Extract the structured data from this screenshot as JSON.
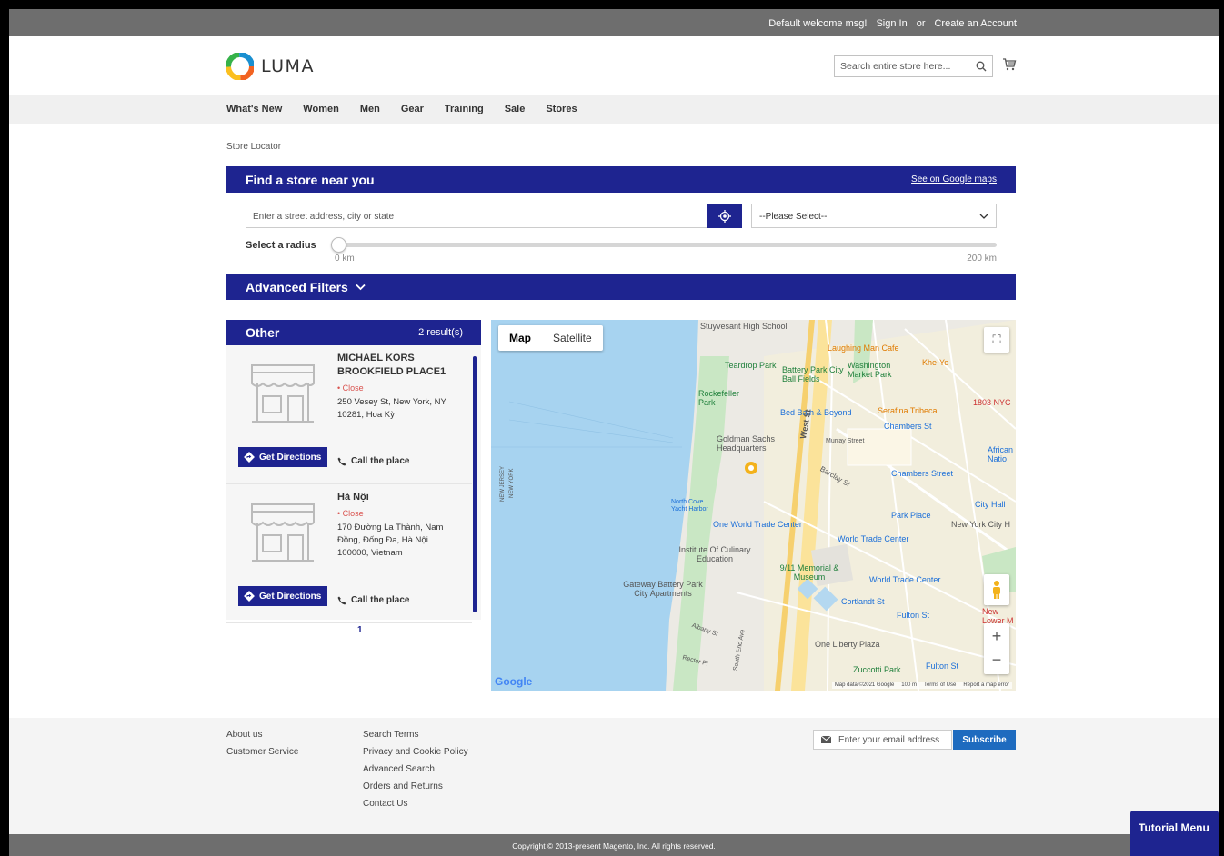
{
  "topbar": {
    "welcome": "Default welcome msg!",
    "sign_in": "Sign In",
    "or": "or",
    "create_account": "Create an Account"
  },
  "header": {
    "logo_text": "LUMA",
    "search_placeholder": "Search entire store here...",
    "icons": [
      "search-icon",
      "cart-icon"
    ]
  },
  "nav": {
    "items": [
      "What's New",
      "Women",
      "Men",
      "Gear",
      "Training",
      "Sale",
      "Stores"
    ]
  },
  "breadcrumb": "Store Locator",
  "finder": {
    "title": "Find a store near you",
    "google_link": "See on Google maps",
    "address_placeholder": "Enter a street address, city or state",
    "select_value": "--Please Select--",
    "radius_label": "Select a radius",
    "radius_min": "0 km",
    "radius_max": "200 km",
    "radius_value_fraction": 0,
    "advanced_filters": "Advanced Filters"
  },
  "results": {
    "group": "Other",
    "count": "2 result(s)",
    "stores": [
      {
        "name": "MICHAEL KORS BROOKFIELD PLACE1",
        "status": "Close",
        "address": "250 Vesey St, New York, NY 10281, Hoa Kỳ",
        "directions": "Get Directions",
        "call": "Call the place"
      },
      {
        "name": "Hà Nội",
        "status": "Close",
        "address": "170 Đường La Thành, Nam Đồng, Đống Đa, Hà Nội 100000, Vietnam",
        "directions": "Get Directions",
        "call": "Call the place"
      }
    ],
    "page": "1"
  },
  "map": {
    "tab_map": "Map",
    "tab_satellite": "Satellite",
    "labels": {
      "stuyvesant": "Stuyvesant High School",
      "laughing_man": "Laughing Man Cafe",
      "khe_yo": "Khe-Yo",
      "teardrop": "Teardrop Park",
      "battery_park_city": "Battery Park City Ball Fields",
      "washington_market": "Washington Market Park",
      "rockefeller": "Rockefeller Park",
      "bed_bath": "Bed Bath & Beyond",
      "serafina": "Serafina Tribeca",
      "nyc1803": "1803 NYC",
      "chambers_st": "Chambers St",
      "goldman": "Goldman Sachs Headquarters",
      "murray": "Murray Street",
      "african": "African Natio",
      "chambers_street": "Chambers Street",
      "west_st": "West St",
      "barclay": "Barclay St",
      "new_jersey": "NEW JERSEY",
      "new_york": "NEW YORK",
      "north_cove": "North Cove Yacht Harbor",
      "one_wtc": "One World Trade Center",
      "park_place": "Park Place",
      "city_hall": "City Hall",
      "ny_city_h": "New York City H",
      "wtc_station": "World Trade Center",
      "institute": "Institute Of Culinary Education",
      "memorial": "9/11 Memorial & Museum",
      "wtc_path": "World Trade Center",
      "gateway": "Gateway Battery Park City Apartments",
      "cortlandt": "Cortlandt St",
      "fulton_st": "Fulton St",
      "new_lower": "New Lower M",
      "one_liberty": "One Liberty Plaza",
      "zuccotti": "Zuccotti Park",
      "fulton_st2": "Fulton St",
      "albany": "Albany St",
      "rector": "Rector Pl",
      "south_end": "South End Ave"
    },
    "footer_data": "Map data ©2021 Google",
    "footer_scale": "100 m",
    "footer_terms": "Terms of Use",
    "footer_report": "Report a map error",
    "google": "Google"
  },
  "footer": {
    "col1": [
      "About us",
      "Customer Service"
    ],
    "col2": [
      "Search Terms",
      "Privacy and Cookie Policy",
      "Advanced Search",
      "Orders and Returns",
      "Contact Us"
    ],
    "newsletter_placeholder": "Enter your email address",
    "subscribe": "Subscribe",
    "copyright": "Copyright © 2013-present Magento, Inc. All rights reserved."
  },
  "tutorial_menu": "Tutorial Menu",
  "colors": {
    "primary": "#1e2490",
    "subscribe": "#1e6bbf",
    "topbar": "#6e6e6e",
    "status_close": "#d9534f"
  }
}
